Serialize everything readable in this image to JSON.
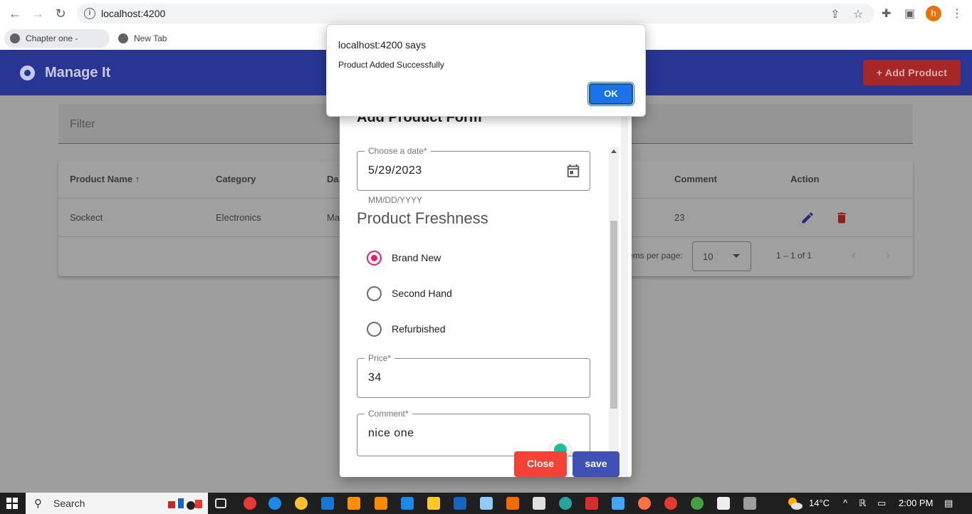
{
  "browser": {
    "url": "localhost:4200",
    "bookmarks": [
      "Chapter one - intro...",
      "New Tab"
    ],
    "profile_initial": "h"
  },
  "app": {
    "title": "Manage It",
    "add_button_label": "+ Add Product"
  },
  "filter": {
    "label": "Filter"
  },
  "table": {
    "headers": {
      "product_name": "Product Name",
      "category": "Category",
      "date": "Da",
      "comment": "Comment",
      "action": "Action"
    },
    "sort_arrow": "↑",
    "row": {
      "product_name": "Sockect",
      "category": "Electronics",
      "date": "Ma",
      "comment": "23"
    },
    "paginator": {
      "items_per_page_label": "ems per page:",
      "page_size": "10",
      "range": "1 – 1 of 1"
    }
  },
  "dialog": {
    "title": "Add Product Form",
    "date_field": {
      "label": "Choose a date*",
      "value": "5/29/2023",
      "hint": "MM/DD/YYYY"
    },
    "freshness_title": "Product Freshness",
    "freshness_options": [
      {
        "label": "Brand New",
        "checked": true
      },
      {
        "label": "Second Hand",
        "checked": false
      },
      {
        "label": "Refurbished",
        "checked": false
      }
    ],
    "price_field": {
      "label": "Price*",
      "value": "34"
    },
    "comment_field": {
      "label": "Comment*",
      "value": "nice one"
    },
    "close_label": "Close",
    "save_label": "save"
  },
  "alert": {
    "title": "localhost:4200 says",
    "message": "Product Added Successfully",
    "ok_label": "OK"
  },
  "taskbar": {
    "search_label": "Search",
    "temperature": "14°C",
    "time": "2:00 PM"
  },
  "colors": {
    "toolbar": "#283593",
    "accent_radio": "#e91e63",
    "close_button": "#f44336",
    "save_button": "#3f51b5",
    "alert_ok": "#1a73e8"
  }
}
